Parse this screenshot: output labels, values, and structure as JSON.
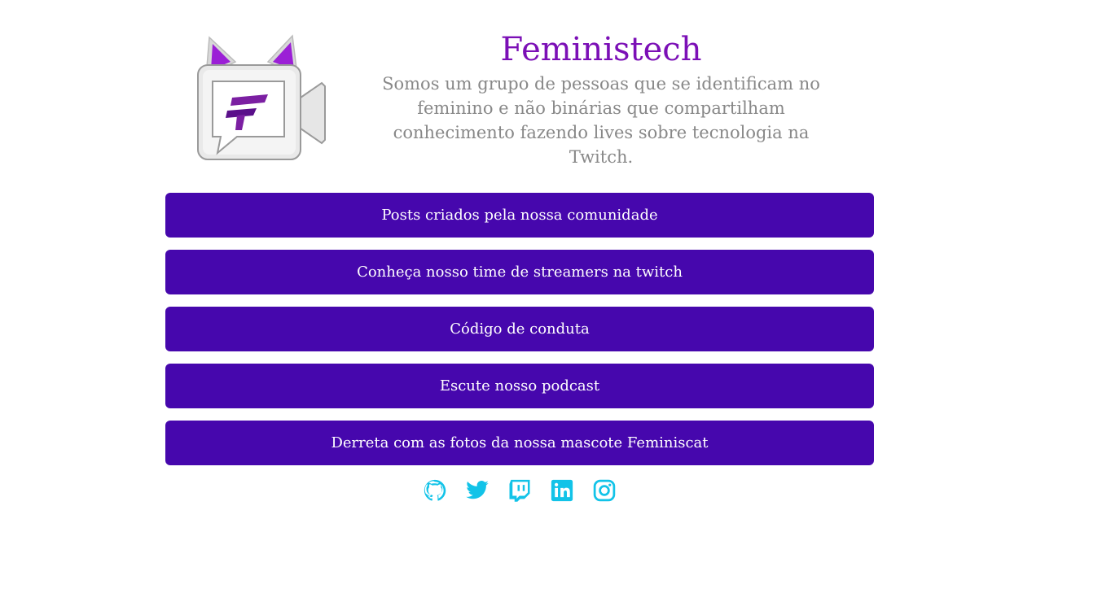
{
  "header": {
    "title": "Feministech",
    "description": "Somos um grupo de pessoas que se identificam no feminino e não binárias que compartilham conhecimento fazendo lives sobre tecnologia na Twitch."
  },
  "links": [
    {
      "label": "Posts criados pela nossa comunidade"
    },
    {
      "label": "Conheça nosso time de streamers na twitch"
    },
    {
      "label": "Código de conduta"
    },
    {
      "label": "Escute nosso podcast"
    },
    {
      "label": "Derreta com as fotos da nossa mascote Feminiscat"
    }
  ],
  "social": [
    {
      "icon": "github-icon"
    },
    {
      "icon": "twitter-icon"
    },
    {
      "icon": "twitch-icon"
    },
    {
      "icon": "linkedin-icon"
    },
    {
      "icon": "instagram-icon"
    }
  ],
  "colors": {
    "title": "#7b0fb6",
    "button": "#4607ad",
    "social": "#12c3e8",
    "description": "#888888"
  }
}
